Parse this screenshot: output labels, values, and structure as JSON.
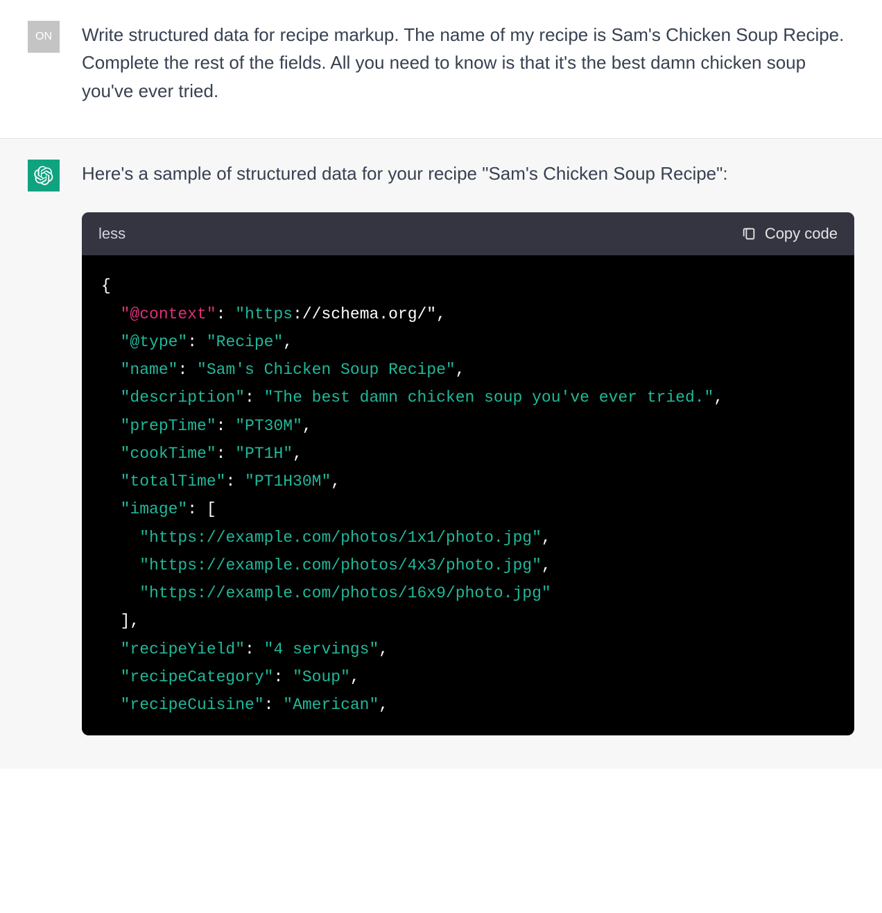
{
  "user": {
    "avatar_label": "ON",
    "text": "Write structured data for recipe markup. The name of my recipe is Sam's Chicken Soup Recipe. Complete the rest of the fields. All you need to know is that it's the best damn chicken soup you've ever tried."
  },
  "assistant": {
    "intro": "Here's a sample of structured data for your recipe \"Sam's Chicken Soup Recipe\":",
    "code_lang": "less",
    "copy_label": "Copy code",
    "code": {
      "context_key": "\"@context\"",
      "context_val_prefix": "\"https",
      "context_val_suffix": "://schema.org/\"",
      "type_key": "\"@type\"",
      "type_val": "\"Recipe\"",
      "name_key": "\"name\"",
      "name_val": "\"Sam's Chicken Soup Recipe\"",
      "desc_key": "\"description\"",
      "desc_val": "\"The best damn chicken soup you've ever tried.\"",
      "prep_key": "\"prepTime\"",
      "prep_val": "\"PT30M\"",
      "cook_key": "\"cookTime\"",
      "cook_val": "\"PT1H\"",
      "total_key": "\"totalTime\"",
      "total_val": "\"PT1H30M\"",
      "image_key": "\"image\"",
      "image_vals": [
        "\"https://example.com/photos/1x1/photo.jpg\"",
        "\"https://example.com/photos/4x3/photo.jpg\"",
        "\"https://example.com/photos/16x9/photo.jpg\""
      ],
      "yield_key": "\"recipeYield\"",
      "yield_val": "\"4 servings\"",
      "cat_key": "\"recipeCategory\"",
      "cat_val": "\"Soup\"",
      "cuisine_key": "\"recipeCuisine\"",
      "cuisine_val": "\"American\""
    }
  }
}
